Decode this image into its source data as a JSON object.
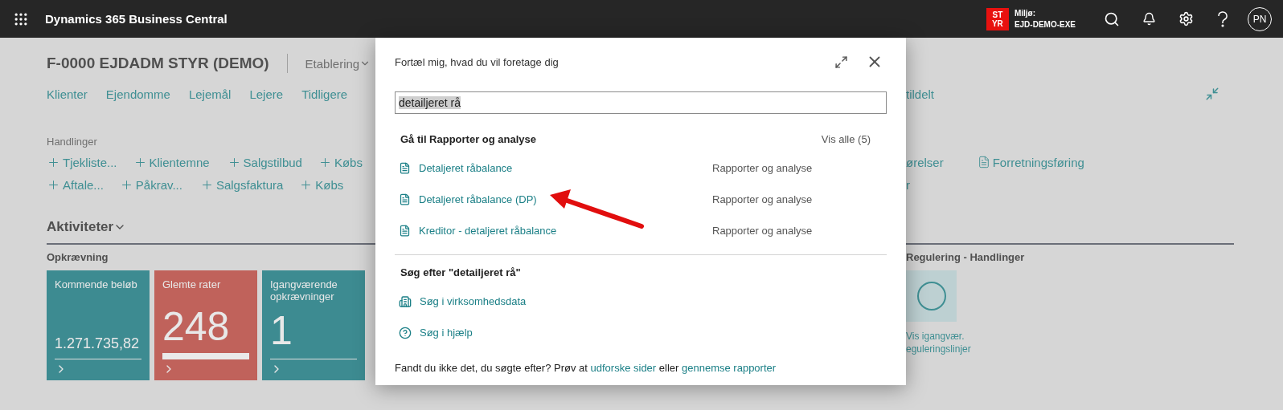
{
  "top_bar": {
    "app_title": "Dynamics 365 Business Central",
    "environment": {
      "badge_lines": [
        "ST",
        "YR"
      ],
      "label": "Miljø:",
      "name": "EJD-DEMO-EXE"
    },
    "avatar": "PN"
  },
  "page": {
    "title": "F-0000 EJDADM STYR (DEMO)",
    "menu": "Etablering",
    "nav_links": [
      "Klienter",
      "Ejendomme",
      "Lejemål",
      "Lejere",
      "Tidligere"
    ],
    "nav_links_right": [
      "tildelt"
    ],
    "actions_label": "Handlinger",
    "action_rows": [
      {
        "left": [
          {
            "kind": "add",
            "label": "Tjekliste..."
          },
          {
            "kind": "add",
            "label": "Klientemne"
          },
          {
            "kind": "add",
            "label": "Salgstilbud"
          },
          {
            "kind": "add",
            "label": "Købs"
          }
        ],
        "right": [
          {
            "kind": "text",
            "label": "ørelser"
          },
          {
            "kind": "report",
            "label": "Forretningsføring"
          }
        ]
      },
      {
        "left": [
          {
            "kind": "add",
            "label": "Aftale..."
          },
          {
            "kind": "add",
            "label": "Påkrav..."
          },
          {
            "kind": "add",
            "label": "Salgsfaktura"
          },
          {
            "kind": "add",
            "label": "Købs"
          }
        ],
        "right": [
          {
            "kind": "text",
            "label": "r"
          }
        ]
      }
    ],
    "activities": {
      "title": "Aktiviteter",
      "group": {
        "title": "Opkrævning",
        "tiles": [
          {
            "kind": "amount",
            "title": "Kommende beløb",
            "value": "1.271.735,82",
            "color": "#3d8b91"
          },
          {
            "kind": "progress",
            "title": "Glemte rater",
            "value": "248",
            "color": "#c0625b"
          },
          {
            "kind": "count",
            "title": "Igangværende opkrævninger",
            "value": "1",
            "color": "#3d8b91"
          }
        ]
      },
      "right_group": {
        "title": "Regulering - Handlinger",
        "action_caption": [
          "Vis igangvær.",
          "eguleringslinjer"
        ]
      }
    }
  },
  "dialog": {
    "prompt": "Fortæl mig, hvad du vil foretage dig",
    "search_value": "detailjeret rå",
    "results_heading": "Gå til Rapporter og analyse",
    "show_all": "Vis alle (5)",
    "results": [
      {
        "name": "Detaljeret råbalance",
        "category": "Rapporter og analyse"
      },
      {
        "name": "Detaljeret råbalance (DP)",
        "category": "Rapporter og analyse"
      },
      {
        "name": "Kreditor - detaljeret råbalance",
        "category": "Rapporter og analyse"
      }
    ],
    "search_heading": "Søg efter \"detailjeret rå\"",
    "search_links": [
      {
        "kind": "data",
        "label": "Søg i virksomhedsdata"
      },
      {
        "kind": "help",
        "label": "Søg i hjælp"
      }
    ],
    "footer": [
      {
        "kind": "text",
        "text": "Fandt du ikke det, du søgte efter? Prøv at"
      },
      {
        "kind": "link",
        "text": "udforske sider"
      },
      {
        "kind": "text",
        "text": "eller"
      },
      {
        "kind": "link",
        "text": "gennemse rapporter"
      }
    ]
  }
}
